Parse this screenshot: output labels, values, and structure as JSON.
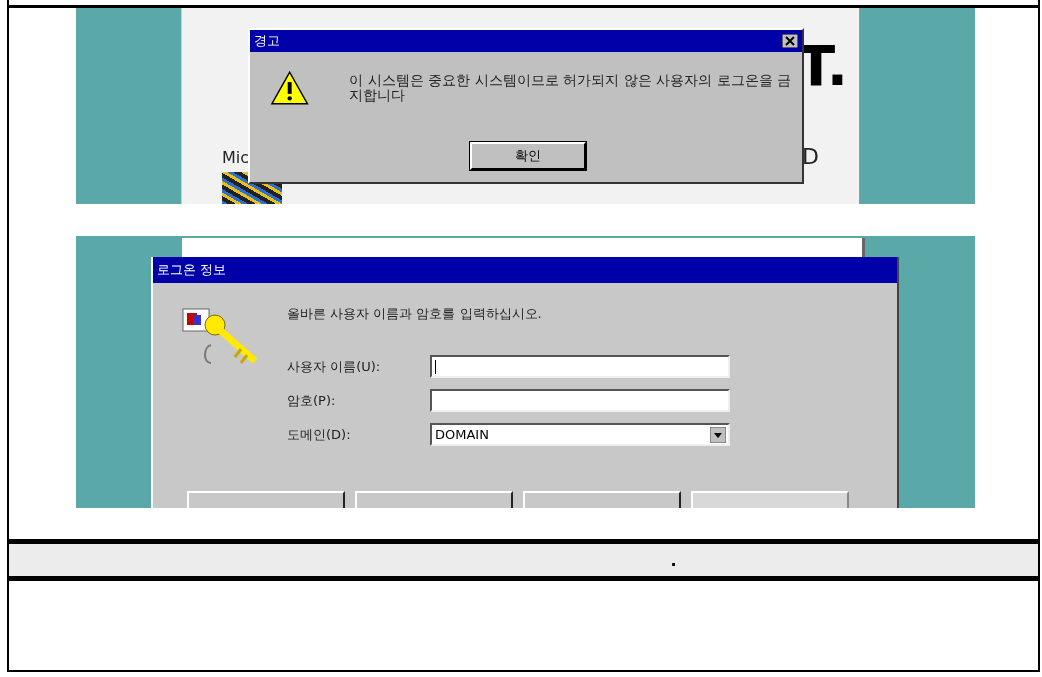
{
  "figure_1": {
    "background": {
      "logo_text": "Mic",
      "large_letters": "T.",
      "side_letter": "D"
    },
    "dialog": {
      "title": "경고",
      "message": "이 시스템은 중요한 시스템이므로 허가되지 않은 사용자의 로그온을 금지합니다",
      "ok_button": "확인"
    }
  },
  "figure_2": {
    "dialog": {
      "title": "로그온 정보",
      "instruction": "올바른 사용자 이름과 암호를 입력하십시오.",
      "fields": [
        {
          "kind": "text",
          "label": "사용자 이름(U):"
        },
        {
          "kind": "password",
          "label": "암호(P):"
        },
        {
          "kind": "dropdown",
          "label": "도메인(D):",
          "value": "DOMAIN"
        }
      ],
      "buttons": [
        {
          "disabled": false
        },
        {
          "disabled": false
        },
        {
          "disabled": false
        },
        {
          "disabled": true
        }
      ]
    }
  },
  "caption": "."
}
